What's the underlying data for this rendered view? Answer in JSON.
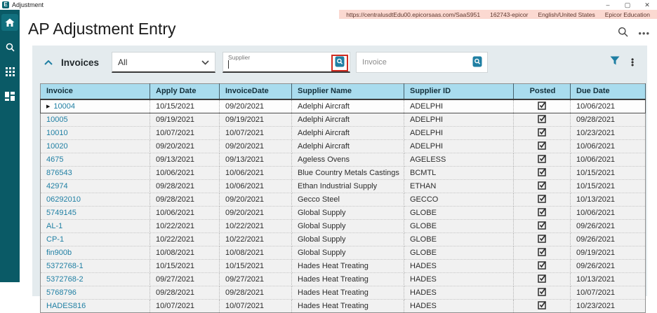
{
  "window": {
    "title": "Adjustment",
    "controls": {
      "minimize": "–",
      "maximize": "▢",
      "close": "✕"
    }
  },
  "env_banner": {
    "url": "https://centralusdtEdu00.epicorsaas.com/SaaS951",
    "tenant": "162743-epicor",
    "locale": "English/United States",
    "environment": "Epicor Education"
  },
  "sidebar": {
    "items": [
      {
        "icon": "home-icon"
      },
      {
        "icon": "search-icon"
      },
      {
        "icon": "apps-grid-icon"
      },
      {
        "icon": "dashboard-icon"
      }
    ]
  },
  "page": {
    "title": "AP Adjustment Entry"
  },
  "panel": {
    "title": "Invoices",
    "filter_dropdown": {
      "value": "All"
    },
    "supplier_field": {
      "label": "Supplier",
      "value": ""
    },
    "invoice_field": {
      "placeholder": "Invoice"
    }
  },
  "colors": {
    "sidebar_teal": "#0a5a66",
    "grid_header_blue": "#a9dcee",
    "accent_teal": "#1f7fa3",
    "highlight_red": "#cf2b20",
    "banner_pink": "#fbd9d1"
  },
  "table": {
    "columns": [
      "Invoice",
      "Apply Date",
      "InvoiceDate",
      "Supplier Name",
      "Supplier ID",
      "Posted",
      "Due Date"
    ],
    "rows": [
      {
        "invoice": "10004",
        "apply_date": "10/15/2021",
        "invoice_date": "09/20/2021",
        "supplier_name": "Adelphi Aircraft",
        "supplier_id": "ADELPHI",
        "posted": true,
        "due_date": "10/06/2021",
        "selected": true
      },
      {
        "invoice": "10005",
        "apply_date": "09/19/2021",
        "invoice_date": "09/19/2021",
        "supplier_name": "Adelphi Aircraft",
        "supplier_id": "ADELPHI",
        "posted": true,
        "due_date": "09/28/2021"
      },
      {
        "invoice": "10010",
        "apply_date": "10/07/2021",
        "invoice_date": "10/07/2021",
        "supplier_name": "Adelphi Aircraft",
        "supplier_id": "ADELPHI",
        "posted": true,
        "due_date": "10/23/2021"
      },
      {
        "invoice": "10020",
        "apply_date": "09/20/2021",
        "invoice_date": "09/20/2021",
        "supplier_name": "Adelphi Aircraft",
        "supplier_id": "ADELPHI",
        "posted": true,
        "due_date": "10/06/2021"
      },
      {
        "invoice": "4675",
        "apply_date": "09/13/2021",
        "invoice_date": "09/13/2021",
        "supplier_name": "Ageless Ovens",
        "supplier_id": "AGELESS",
        "posted": true,
        "due_date": "10/06/2021"
      },
      {
        "invoice": "876543",
        "apply_date": "10/06/2021",
        "invoice_date": "10/06/2021",
        "supplier_name": "Blue Country Metals Castings",
        "supplier_id": "BCMTL",
        "posted": true,
        "due_date": "10/15/2021"
      },
      {
        "invoice": "42974",
        "apply_date": "09/28/2021",
        "invoice_date": "10/06/2021",
        "supplier_name": "Ethan Industrial Supply",
        "supplier_id": "ETHAN",
        "posted": true,
        "due_date": "10/15/2021"
      },
      {
        "invoice": "06292010",
        "apply_date": "09/28/2021",
        "invoice_date": "09/20/2021",
        "supplier_name": "Gecco Steel",
        "supplier_id": "GECCO",
        "posted": true,
        "due_date": "10/13/2021"
      },
      {
        "invoice": "5749145",
        "apply_date": "10/06/2021",
        "invoice_date": "09/20/2021",
        "supplier_name": "Global Supply",
        "supplier_id": "GLOBE",
        "posted": true,
        "due_date": "10/06/2021"
      },
      {
        "invoice": "AL-1",
        "apply_date": "10/22/2021",
        "invoice_date": "10/22/2021",
        "supplier_name": "Global Supply",
        "supplier_id": "GLOBE",
        "posted": true,
        "due_date": "09/26/2021"
      },
      {
        "invoice": "CP-1",
        "apply_date": "10/22/2021",
        "invoice_date": "10/22/2021",
        "supplier_name": "Global Supply",
        "supplier_id": "GLOBE",
        "posted": true,
        "due_date": "09/26/2021"
      },
      {
        "invoice": "fin900b",
        "apply_date": "10/08/2021",
        "invoice_date": "10/08/2021",
        "supplier_name": "Global Supply",
        "supplier_id": "GLOBE",
        "posted": true,
        "due_date": "09/19/2021"
      },
      {
        "invoice": "5372768-1",
        "apply_date": "10/15/2021",
        "invoice_date": "10/15/2021",
        "supplier_name": "Hades Heat Treating",
        "supplier_id": "HADES",
        "posted": true,
        "due_date": "09/26/2021"
      },
      {
        "invoice": "5372768-2",
        "apply_date": "09/27/2021",
        "invoice_date": "09/27/2021",
        "supplier_name": "Hades Heat Treating",
        "supplier_id": "HADES",
        "posted": true,
        "due_date": "10/13/2021"
      },
      {
        "invoice": "5768796",
        "apply_date": "09/28/2021",
        "invoice_date": "09/28/2021",
        "supplier_name": "Hades Heat Treating",
        "supplier_id": "HADES",
        "posted": true,
        "due_date": "10/07/2021"
      },
      {
        "invoice": "HADES816",
        "apply_date": "10/07/2021",
        "invoice_date": "10/07/2021",
        "supplier_name": "Hades Heat Treating",
        "supplier_id": "HADES",
        "posted": true,
        "due_date": "10/23/2021"
      }
    ]
  }
}
